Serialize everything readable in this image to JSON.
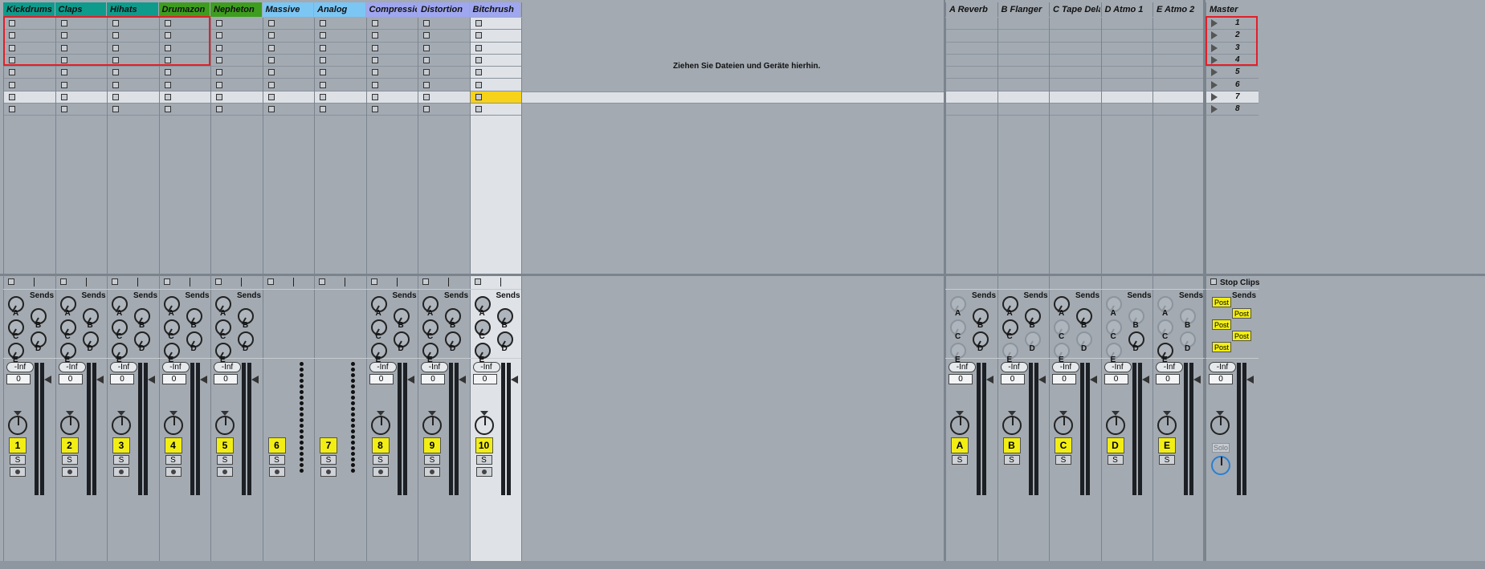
{
  "tracks": [
    {
      "name": "Kickdrums",
      "color": "#0e9b8c",
      "number": "1"
    },
    {
      "name": "Claps",
      "color": "#0e9b8c",
      "number": "2"
    },
    {
      "name": "Hihats",
      "color": "#0e9b8c",
      "number": "3"
    },
    {
      "name": "Drumazon",
      "color": "#3e9d1e",
      "number": "4"
    },
    {
      "name": "Nepheton",
      "color": "#3e9d1e",
      "number": "5"
    },
    {
      "name": "Massive",
      "color": "#7cc6f4",
      "number": "6"
    },
    {
      "name": "Analog",
      "color": "#7cc6f4",
      "number": "7"
    },
    {
      "name": "Compression",
      "color": "#9fa7f0",
      "number": "8"
    },
    {
      "name": "Distortion",
      "color": "#9fa7f0",
      "number": "9"
    },
    {
      "name": "Bitchrush",
      "color": "#9fa7f0",
      "number": "10"
    }
  ],
  "returns": [
    {
      "name": "A Reverb",
      "letter": "A"
    },
    {
      "name": "B Flanger",
      "letter": "B"
    },
    {
      "name": "C Tape Dela",
      "letter": "C"
    },
    {
      "name": "D Atmo 1",
      "letter": "D"
    },
    {
      "name": "E Atmo 2",
      "letter": "E"
    }
  ],
  "master": {
    "name": "Master",
    "stop_clips": "Stop Clips",
    "solo": "Solo",
    "scenes": [
      "1",
      "2",
      "3",
      "4",
      "5",
      "6",
      "7",
      "8"
    ]
  },
  "drop_message": "Ziehen Sie Dateien und Geräte hierhin.",
  "labels": {
    "sends": "Sends",
    "inf": "-Inf",
    "volume": "0",
    "solo_btn": "S",
    "post": "Post",
    "send_letters": [
      "A",
      "B",
      "C",
      "D",
      "E"
    ]
  }
}
